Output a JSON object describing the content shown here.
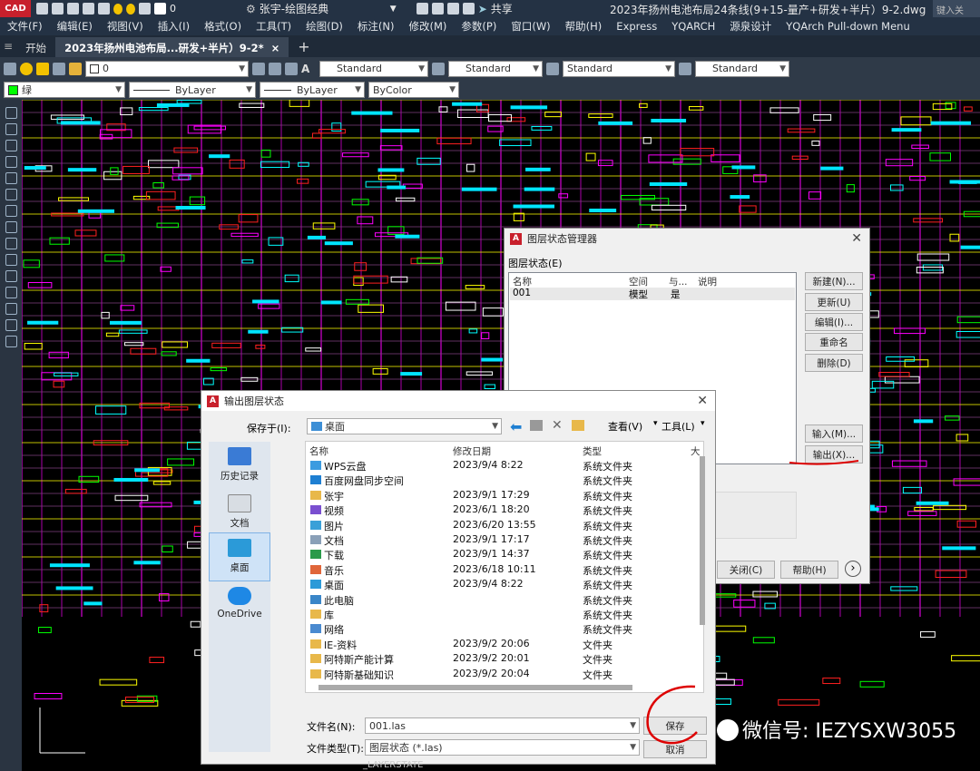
{
  "app": {
    "logo": "CAD",
    "title": "2023年扬州电池布局24条线(9+15-量产+研发+半片）9-2.dwg",
    "keyin": "键入关",
    "layer_value": "0",
    "workspace": "张宇-绘图经典",
    "share": "共享"
  },
  "menu": [
    "文件(F)",
    "编辑(E)",
    "视图(V)",
    "插入(I)",
    "格式(O)",
    "工具(T)",
    "绘图(D)",
    "标注(N)",
    "修改(M)",
    "参数(P)",
    "窗口(W)",
    "帮助(H)",
    "Express",
    "YQARCH",
    "源泉设计",
    "YQArch Pull-down Menu"
  ],
  "tabs": {
    "start": "开始",
    "active": "2023年扬州电池布局...研发+半片）9-2*",
    "plus": "+"
  },
  "toolbar1": {
    "layer": "0",
    "text_style": "Standard",
    "dim_style": "Standard",
    "table_style": "Standard",
    "mleader_style": "Standard"
  },
  "toolbar2": {
    "color": "绿",
    "color_hex": "#00ff00",
    "linetype": "ByLayer",
    "lineweight": "ByLayer",
    "plotstyle": "ByColor"
  },
  "layer_manager": {
    "title": "图层状态管理器",
    "section_label": "图层状态(E)",
    "columns": [
      "名称",
      "空间",
      "与...",
      "说明"
    ],
    "rows": [
      {
        "name": "001",
        "space": "模型",
        "match": "是",
        "desc": ""
      }
    ],
    "buttons": {
      "new": "新建(N)...",
      "update": "更新(U)",
      "edit": "编辑(I)...",
      "rename": "重命名",
      "delete": "删除(D)",
      "import": "输入(M)...",
      "export": "输出(X)..."
    },
    "close": "关闭(C)",
    "help": "帮助(H)",
    "more": "›"
  },
  "save_dialog": {
    "title": "输出图层状态",
    "save_in_label": "保存于(I):",
    "save_in_value": "桌面",
    "view_label": "查看(V)",
    "tools_label": "工具(L)",
    "places": [
      "历史记录",
      "文档",
      "桌面",
      "OneDrive"
    ],
    "columns": [
      "名称",
      "修改日期",
      "类型",
      "大"
    ],
    "files": [
      {
        "name": "WPS云盘",
        "date": "2023/9/4 8:22",
        "type": "系统文件夹",
        "icon": "cloud-icon"
      },
      {
        "name": "百度网盘同步空间",
        "date": "",
        "type": "系统文件夹",
        "icon": "sync-folder-icon"
      },
      {
        "name": "张宇",
        "date": "2023/9/1 17:29",
        "type": "系统文件夹",
        "icon": "folder-icon"
      },
      {
        "name": "视频",
        "date": "2023/6/1 18:20",
        "type": "系统文件夹",
        "icon": "video-icon"
      },
      {
        "name": "图片",
        "date": "2023/6/20 13:55",
        "type": "系统文件夹",
        "icon": "picture-icon"
      },
      {
        "name": "文档",
        "date": "2023/9/1 17:17",
        "type": "系统文件夹",
        "icon": "document-icon"
      },
      {
        "name": "下载",
        "date": "2023/9/1 14:37",
        "type": "系统文件夹",
        "icon": "download-icon"
      },
      {
        "name": "音乐",
        "date": "2023/6/18 10:11",
        "type": "系统文件夹",
        "icon": "music-icon"
      },
      {
        "name": "桌面",
        "date": "2023/9/4 8:22",
        "type": "系统文件夹",
        "icon": "desktop-icon"
      },
      {
        "name": "此电脑",
        "date": "",
        "type": "系统文件夹",
        "icon": "computer-icon"
      },
      {
        "name": "库",
        "date": "",
        "type": "系统文件夹",
        "icon": "library-icon"
      },
      {
        "name": "网络",
        "date": "",
        "type": "系统文件夹",
        "icon": "network-icon"
      },
      {
        "name": "IE-资料",
        "date": "2023/9/2 20:06",
        "type": "文件夹",
        "icon": "folder-icon"
      },
      {
        "name": "阿特斯产能计算",
        "date": "2023/9/2 20:01",
        "type": "文件夹",
        "icon": "folder-icon"
      },
      {
        "name": "阿特斯基础知识",
        "date": "2023/9/2 20:04",
        "type": "文件夹",
        "icon": "folder-icon"
      }
    ],
    "filename_label": "文件名(N):",
    "filename_value": "001.las",
    "filetype_label": "文件类型(T):",
    "filetype_value": "图层状态 (*.las)",
    "save": "保存",
    "cancel": "取消"
  },
  "watermark": "微信号: IEZYSXW3055",
  "command_line": "_LAYERSTATE"
}
